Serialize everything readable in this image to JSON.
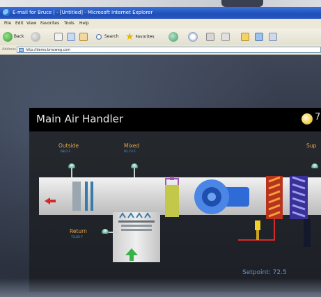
{
  "window": {
    "title": "E-mail for Bruce | - [Untitled] - Microsoft Internet Explorer"
  },
  "menu": {
    "items": [
      "File",
      "Edit",
      "View",
      "Favorites",
      "Tools",
      "Help"
    ]
  },
  "toolbar": {
    "back_label": "Back",
    "search_label": "Search",
    "favorites_label": "Favorites"
  },
  "address": {
    "label": "Address",
    "value": "http://demo.bmsweg.com"
  },
  "app": {
    "title": "Main Air Handler",
    "weather_text": "7"
  },
  "sensors": {
    "outside": {
      "label": "Outside",
      "value": "68.0 F"
    },
    "mixed": {
      "label": "Mixed",
      "value": "91.73 F"
    },
    "supply": {
      "label": "Sup",
      "value": ""
    },
    "return": {
      "label": "Return",
      "value": "73.05 F"
    }
  },
  "setpoint": {
    "text": "Setpoint: 72.5"
  },
  "colors": {
    "sensor_label": "#e8a64a",
    "sensor_value": "#4aa3e6",
    "panel_header": "#000000",
    "titlebar": "#2755c2"
  }
}
